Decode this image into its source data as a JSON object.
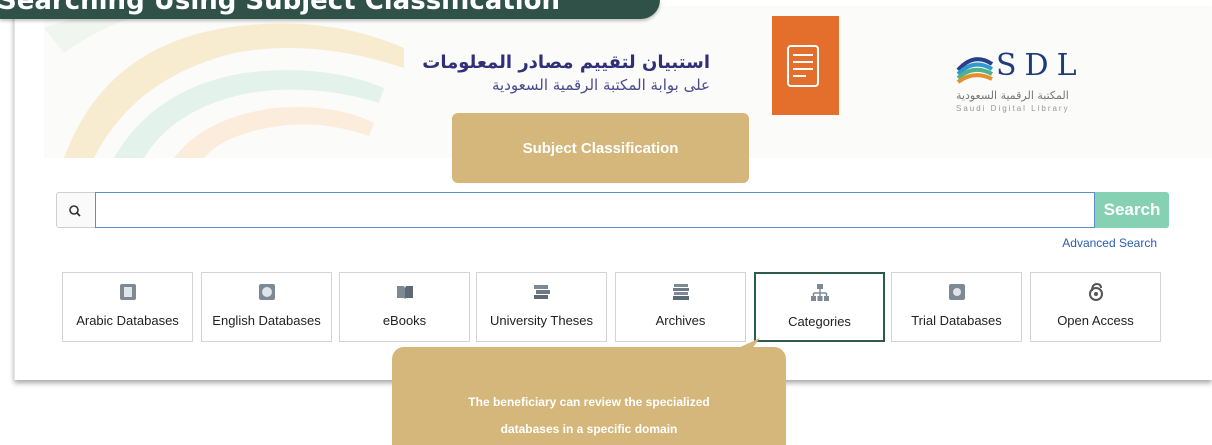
{
  "title_banner": {
    "text": "Searching Using Subject Classification"
  },
  "banner": {
    "arabic_title": "استبيان لتقييم مصادر المعلومات",
    "arabic_subtitle": "على بوابة المكتبة الرقمية السعودية",
    "logo_letters": "SDL",
    "logo_arabic": "المكتبة الرقمية السعودية",
    "logo_english": "Saudi Digital Library"
  },
  "highlight_label": "Subject Classification",
  "search": {
    "input_value": "",
    "button_label": "Search",
    "advanced_link": "Advanced Search"
  },
  "categories": [
    {
      "label": "Arabic Databases",
      "icon": "arabic-database-icon"
    },
    {
      "label": "English Databases",
      "icon": "english-database-icon"
    },
    {
      "label": "eBooks",
      "icon": "ebook-icon"
    },
    {
      "label": "University Theses",
      "icon": "thesis-icon"
    },
    {
      "label": "Archives",
      "icon": "archives-icon"
    },
    {
      "label": "Categories",
      "icon": "categories-icon",
      "active": true
    },
    {
      "label": "Trial Databases",
      "icon": "trial-database-icon"
    },
    {
      "label": "Open Access",
      "icon": "open-access-icon"
    }
  ],
  "callout": {
    "line1": "The beneficiary can review the specialized",
    "line2": "databases in a specific domain"
  },
  "colors": {
    "banner_green": "#2f5148",
    "gold": "#d5b77b",
    "search_button": "#86d0b4",
    "doc_orange": "#e46f2c",
    "active_border": "#2d5a4c",
    "link_blue": "#2a5db0"
  }
}
